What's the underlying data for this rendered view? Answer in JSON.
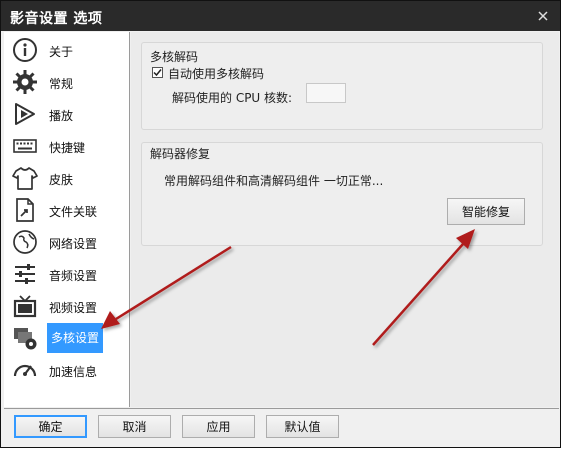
{
  "window": {
    "title": "影音设置 选项"
  },
  "sidebar": {
    "items": [
      {
        "label": "关于",
        "icon": "info-icon"
      },
      {
        "label": "常规",
        "icon": "gear-icon"
      },
      {
        "label": "播放",
        "icon": "play-icon"
      },
      {
        "label": "快捷键",
        "icon": "keyboard-icon"
      },
      {
        "label": "皮肤",
        "icon": "shirt-icon"
      },
      {
        "label": "文件关联",
        "icon": "file-link-icon"
      },
      {
        "label": "网络设置",
        "icon": "network-icon"
      },
      {
        "label": "音频设置",
        "icon": "audio-icon"
      },
      {
        "label": "视频设置",
        "icon": "tv-icon"
      },
      {
        "label": "多核设置",
        "icon": "multicore-icon",
        "selected": true
      },
      {
        "label": "加速信息",
        "icon": "speedometer-icon"
      }
    ]
  },
  "multicore": {
    "title": "多核解码",
    "auto_label": "自动使用多核解码",
    "auto_checked": true,
    "cores_label": "解码使用的 CPU 核数:",
    "cores_value": ""
  },
  "repair": {
    "title": "解码器修复",
    "status": "常用解码组件和高清解码组件 一切正常...",
    "button_label": "智能修复"
  },
  "footer": {
    "ok": "确定",
    "cancel": "取消",
    "apply": "应用",
    "default": "默认值"
  },
  "colors": {
    "selection": "#3399ff",
    "annotation_arrow": "#b01c1c",
    "titlebar": "#2a2a2a"
  }
}
